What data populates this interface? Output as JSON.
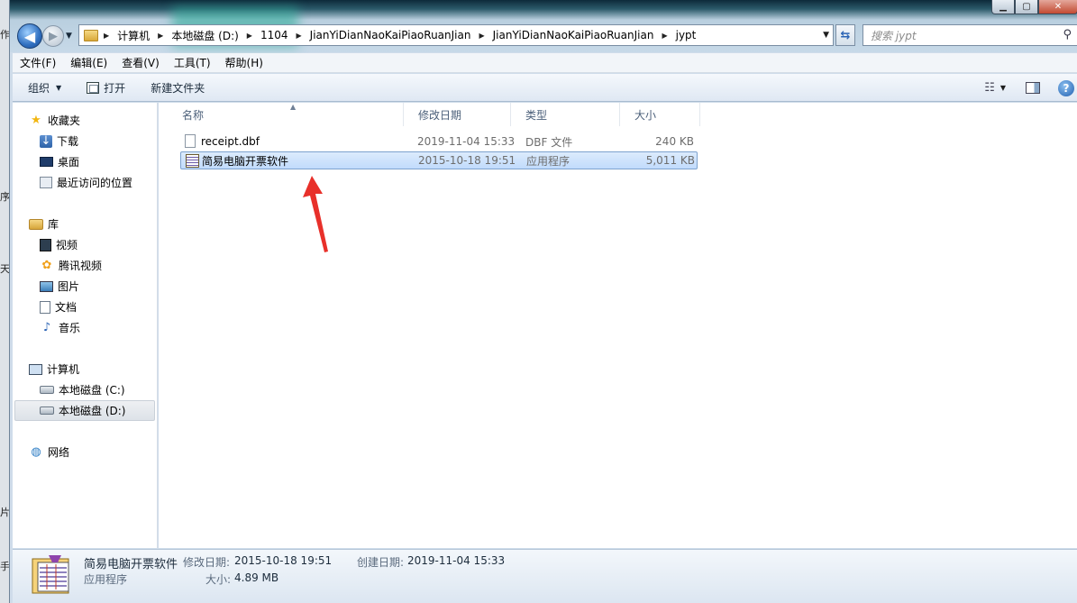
{
  "background_fragments": [
    "作",
    "序",
    "天",
    "片",
    "手"
  ],
  "nav_buttons": {
    "back_glyph": "◀",
    "forward_glyph": "▶"
  },
  "address": {
    "crumbs": [
      "计算机",
      "本地磁盘 (D:)",
      "1104",
      "JianYiDianNaoKaiPiaoRuanJian",
      "JianYiDianNaoKaiPiaoRuanJian",
      "jypt"
    ]
  },
  "search": {
    "placeholder": "搜索 jypt"
  },
  "menu": [
    "文件(F)",
    "编辑(E)",
    "查看(V)",
    "工具(T)",
    "帮助(H)"
  ],
  "toolbar": {
    "organize": "组织",
    "open": "打开",
    "new_folder": "新建文件夹"
  },
  "sidebar": {
    "favorites": {
      "label": "收藏夹",
      "items": [
        "下载",
        "桌面",
        "最近访问的位置"
      ]
    },
    "libraries": {
      "label": "库",
      "items": [
        "视频",
        "腾讯视频",
        "图片",
        "文档",
        "音乐"
      ]
    },
    "computer": {
      "label": "计算机",
      "items": [
        "本地磁盘 (C:)",
        "本地磁盘 (D:)"
      ],
      "selected": "本地磁盘 (D:)"
    },
    "network": {
      "label": "网络"
    }
  },
  "columns": {
    "name": "名称",
    "modified": "修改日期",
    "type": "类型",
    "size": "大小"
  },
  "files": [
    {
      "name": "receipt.dbf",
      "modified": "2019-11-04 15:33",
      "type": "DBF 文件",
      "size": "240 KB",
      "icon": "dbf-file-icon"
    },
    {
      "name": "简易电脑开票软件",
      "modified": "2015-10-18 19:51",
      "type": "应用程序",
      "size": "5,011 KB",
      "icon": "application-icon",
      "selected": true
    }
  ],
  "details": {
    "name": "简易电脑开票软件",
    "type": "应用程序",
    "modified_label": "修改日期:",
    "modified_value": "2015-10-18 19:51",
    "created_label": "创建日期:",
    "created_value": "2019-11-04 15:33",
    "size_label": "大小:",
    "size_value": "4.89 MB"
  },
  "colors": {
    "selection_bg": "#c9e0fc",
    "selection_border": "#7da2ce",
    "annotation_arrow": "#e8302a"
  }
}
